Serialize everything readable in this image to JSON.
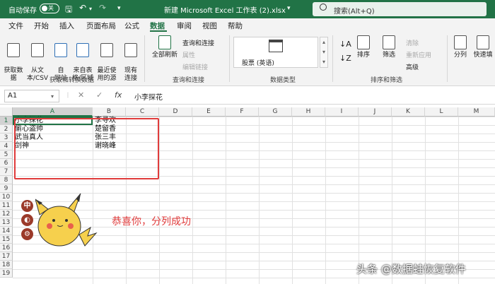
{
  "titlebar": {
    "autosave_label": "自动保存",
    "autosave_state": "关",
    "title": "新建 Microsoft Excel 工作表 (2).xlsx",
    "search_placeholder": "搜索(Alt+Q)"
  },
  "menu": {
    "tabs": [
      "文件",
      "开始",
      "插入",
      "页面布局",
      "公式",
      "数据",
      "审阅",
      "视图",
      "帮助"
    ],
    "active_tab": "数据"
  },
  "ribbon": {
    "get_data": "获取数\n据",
    "from_text_csv": "从文\n本/CSV",
    "from_web": "自\n网站",
    "from_table": "来自表\n格/区域",
    "recent_sources": "最近使\n用的源",
    "existing_connections": "现有\n连接",
    "group_get_transform": "获取和转换数据",
    "refresh_all": "全部刷新",
    "queries_connections": "查询和连接",
    "properties": "属性",
    "edit_links": "编辑链接",
    "group_queries": "查询和连接",
    "stocks": "股票 (英语)",
    "group_data_types": "数据类型",
    "sort": "排序",
    "filter": "筛选",
    "clear": "清除",
    "reapply": "重新应用",
    "advanced": "高级",
    "group_sort_filter": "排序和筛选",
    "text_to_columns": "分列",
    "flash_fill": "快速填"
  },
  "formula_bar": {
    "name_box": "A1",
    "cancel": "✕",
    "enter": "✓",
    "fx": "fx",
    "content": "小李探花"
  },
  "grid": {
    "columns": [
      "A",
      "B",
      "C",
      "D",
      "E",
      "F",
      "G",
      "H",
      "I",
      "J",
      "K",
      "L",
      "M"
    ],
    "rows": [
      "1",
      "2",
      "3",
      "4",
      "5",
      "6",
      "7",
      "8",
      "9",
      "10",
      "11",
      "12",
      "13",
      "14",
      "15",
      "16",
      "17",
      "18",
      "19"
    ],
    "data": [
      [
        "小李探花",
        "李寻欢"
      ],
      [
        "偷心盗帅",
        "楚留香"
      ],
      [
        "武当真人",
        "张三丰"
      ],
      [
        "剑神",
        "谢晓峰"
      ]
    ]
  },
  "overlay": {
    "message": "恭喜你，分列成功",
    "badges": [
      "中",
      "◐",
      "⚙"
    ],
    "watermark": "头条 @数据蛙恢复软件"
  },
  "colors": {
    "accent": "#217346",
    "highlight_red": "#e03b3b"
  }
}
